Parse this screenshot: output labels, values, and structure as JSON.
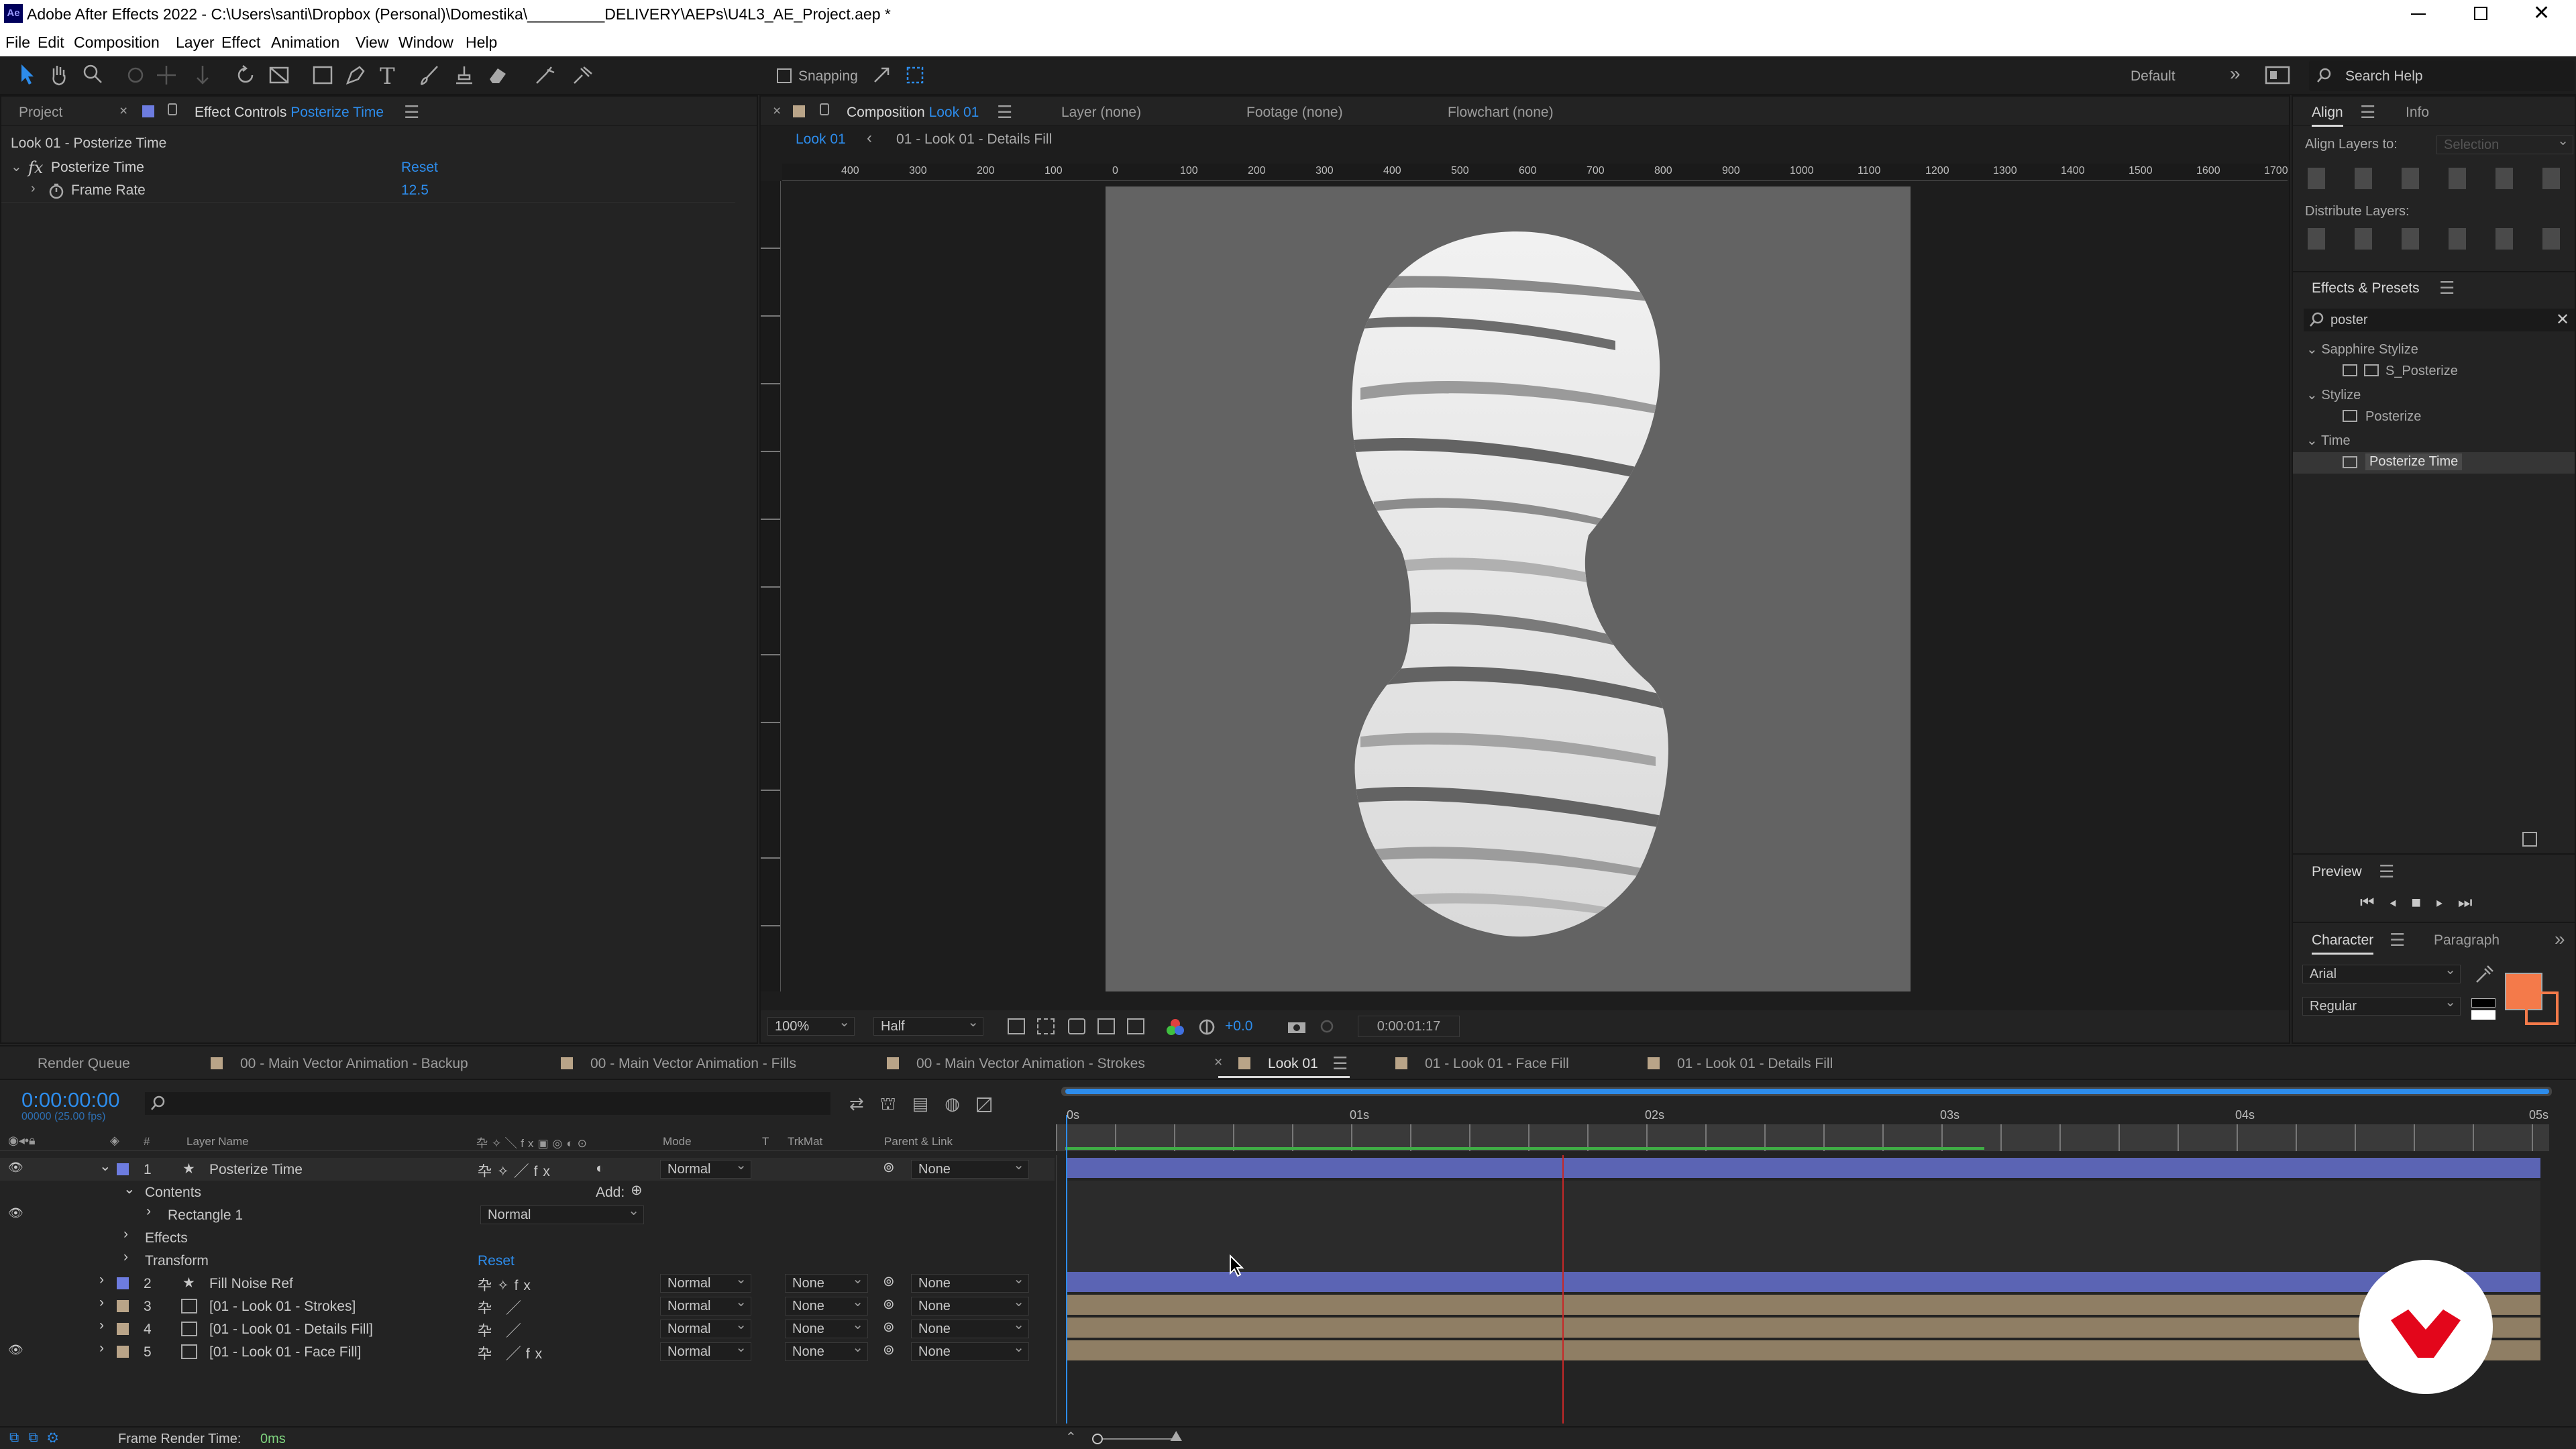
{
  "app": {
    "title": "Adobe After Effects 2022 - C:\\Users\\santi\\Dropbox (Personal)\\Domestika\\_________DELIVERY\\AEPs\\U4L3_AE_Project.aep *",
    "logo_text": "Ae"
  },
  "menu": [
    "File",
    "Edit",
    "Composition",
    "Layer",
    "Effect",
    "Animation",
    "View",
    "Window",
    "Help"
  ],
  "toolbar": {
    "snapping_label": "Snapping",
    "workspace": "Default",
    "search_placeholder": "Search Help"
  },
  "project_panel": {
    "tab_project": "Project",
    "tab_effect_controls": "Effect Controls",
    "ec_layer": "Posterize Time",
    "breadcrumb": "Look 01 - Posterize Time",
    "effect_name": "Posterize Time",
    "reset_label": "Reset",
    "param_label": "Frame Rate",
    "param_value": "12.5"
  },
  "viewer": {
    "tab_composition": "Composition",
    "comp_name": "Look 01",
    "tab_layer": "Layer  (none)",
    "tab_footage": "Footage  (none)",
    "tab_flowchart": "Flowchart  (none)",
    "breadcrumb_1": "Look 01",
    "breadcrumb_2": "01 - Look 01 - Details Fill",
    "ruler": [
      "400",
      "300",
      "200",
      "100",
      "0",
      "100",
      "200",
      "300",
      "400",
      "500",
      "600",
      "700",
      "800",
      "900",
      "1000",
      "1100",
      "1200",
      "1300",
      "1400",
      "1500",
      "1600",
      "1700"
    ],
    "zoom": "100%",
    "resolution": "Half",
    "exposure": "+0.0",
    "timecode": "0:00:01:17"
  },
  "right_panel": {
    "tab_align": "Align",
    "tab_info": "Info",
    "align_layers_to": "Align Layers to:",
    "align_target": "Selection",
    "distribute_layers": "Distribute Layers:",
    "effects_presets": "Effects & Presets",
    "search_value": "poster",
    "tree": [
      {
        "label": "Sapphire Stylize",
        "level": 0
      },
      {
        "label": "S_Posterize",
        "level": 1
      },
      {
        "label": "Stylize",
        "level": 0
      },
      {
        "label": "Posterize",
        "level": 1
      },
      {
        "label": "Time",
        "level": 0
      },
      {
        "label": "Posterize Time",
        "level": 1,
        "selected": true
      }
    ],
    "preview": "Preview",
    "tab_character": "Character",
    "tab_paragraph": "Paragraph",
    "font": "Arial",
    "font_style": "Regular",
    "fill_color": "#f47a4a"
  },
  "timeline": {
    "tabs": [
      {
        "label": "Render Queue",
        "color": null
      },
      {
        "label": "00 - Main Vector Animation - Backup",
        "color": "#b9a488"
      },
      {
        "label": "00 - Main Vector Animation - Fills",
        "color": "#b9a488"
      },
      {
        "label": "00 - Main Vector Animation - Strokes",
        "color": "#b9a488"
      },
      {
        "label": "Look 01",
        "color": "#b9a488",
        "active": true
      },
      {
        "label": "01 - Look 01 - Face Fill",
        "color": "#b9a488"
      },
      {
        "label": "01 - Look 01 - Details Fill",
        "color": "#b9a488"
      }
    ],
    "timecode": "0:00:00:00",
    "fps_sub": "00000 (25.00 fps)",
    "headers": {
      "num": "#",
      "layer_name": "Layer Name",
      "mode": "Mode",
      "t": "T",
      "trkmat": "TrkMat",
      "parent": "Parent & Link"
    },
    "time_ticks": [
      "0s",
      "01s",
      "02s",
      "03s",
      "04s",
      "05s"
    ],
    "layers": [
      {
        "num": "1",
        "name": "Posterize Time",
        "label_color": "#6d7ce0",
        "mode": "Normal",
        "trkmat": "",
        "parent": "None",
        "star": true,
        "expanded": true,
        "bar_color": "#5b64b4"
      },
      {
        "num": "2",
        "name": "Fill Noise Ref",
        "label_color": "#6d7ce0",
        "mode": "Normal",
        "trkmat": "None",
        "parent": "None",
        "star": true,
        "bar_color": "#5b64b4"
      },
      {
        "num": "3",
        "name": "[01 - Look 01 - Strokes]",
        "label_color": "#b9a488",
        "mode": "Normal",
        "trkmat": "None",
        "parent": "None",
        "bar_color": "#8f7e64"
      },
      {
        "num": "4",
        "name": "[01 - Look 01 - Details Fill]",
        "label_color": "#b9a488",
        "mode": "Normal",
        "trkmat": "None",
        "parent": "None",
        "bar_color": "#8f7e64"
      },
      {
        "num": "5",
        "name": "[01 - Look 01 - Face Fill]",
        "label_color": "#b9a488",
        "mode": "Normal",
        "trkmat": "None",
        "parent": "None",
        "bar_color": "#8f7e64"
      }
    ],
    "sub": {
      "contents": "Contents",
      "add": "Add:",
      "rectangle": "Rectangle 1",
      "rect_mode": "Normal",
      "effects": "Effects",
      "transform": "Transform",
      "reset": "Reset"
    },
    "frame_render_label": "Frame Render Time:",
    "frame_render_value": "0ms"
  }
}
